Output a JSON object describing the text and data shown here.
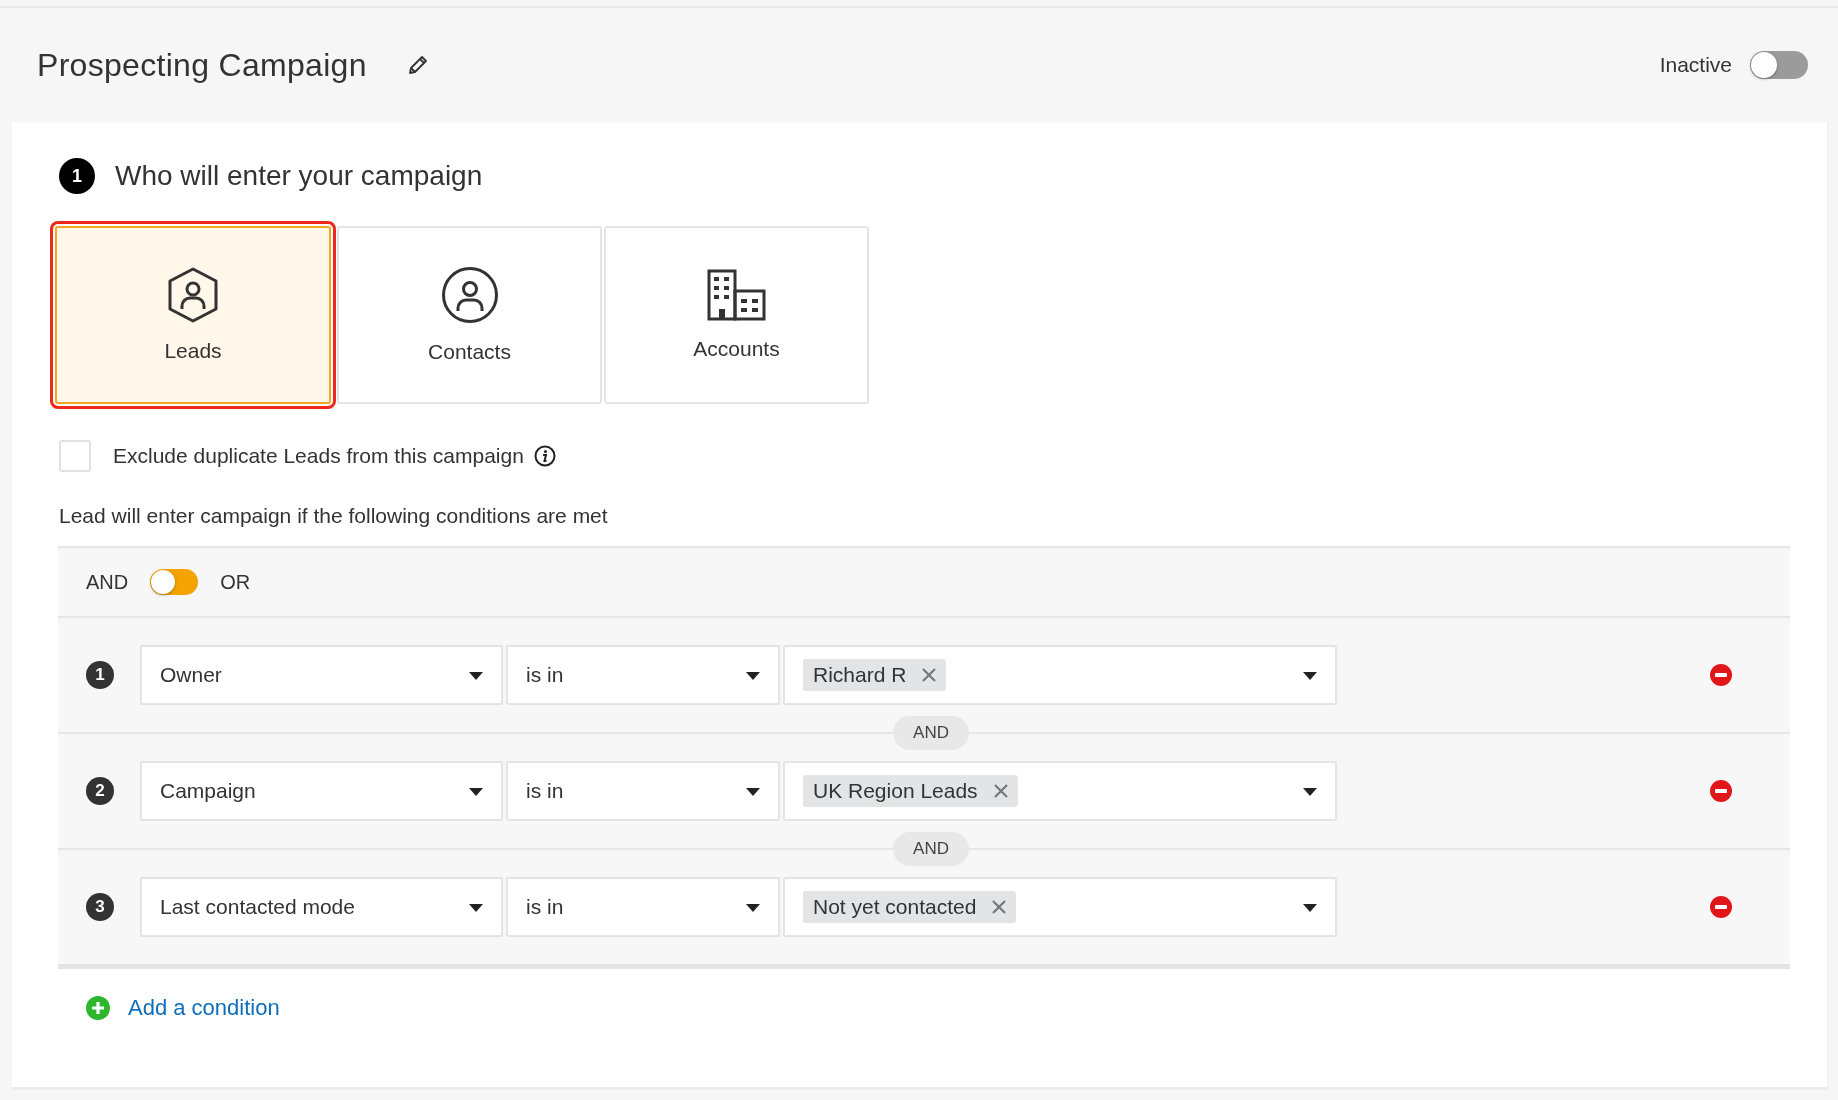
{
  "campaign": {
    "title": "Prospecting Campaign",
    "status_label": "Inactive",
    "active": false
  },
  "step": {
    "number": "1",
    "title": "Who will enter your campaign"
  },
  "entity_types": [
    {
      "label": "Leads",
      "kind": "lead",
      "selected": true
    },
    {
      "label": "Contacts",
      "kind": "contact",
      "selected": false
    },
    {
      "label": "Accounts",
      "kind": "account",
      "selected": false
    }
  ],
  "exclude_duplicates": {
    "label": "Exclude duplicate Leads from this campaign",
    "checked": false
  },
  "conditions_intro": "Lead will enter campaign if the following conditions are met",
  "match": {
    "and_label": "AND",
    "or_label": "OR",
    "or_selected": false
  },
  "conditions": [
    {
      "number": "1",
      "field": "Owner",
      "operator": "is in",
      "values": [
        "Richard R"
      ],
      "joiner": "AND"
    },
    {
      "number": "2",
      "field": "Campaign",
      "operator": "is in",
      "values": [
        "UK Region Leads"
      ],
      "joiner": "AND"
    },
    {
      "number": "3",
      "field": "Last contacted mode",
      "operator": "is in",
      "values": [
        "Not yet contacted"
      ]
    }
  ],
  "add_condition": "Add a condition"
}
